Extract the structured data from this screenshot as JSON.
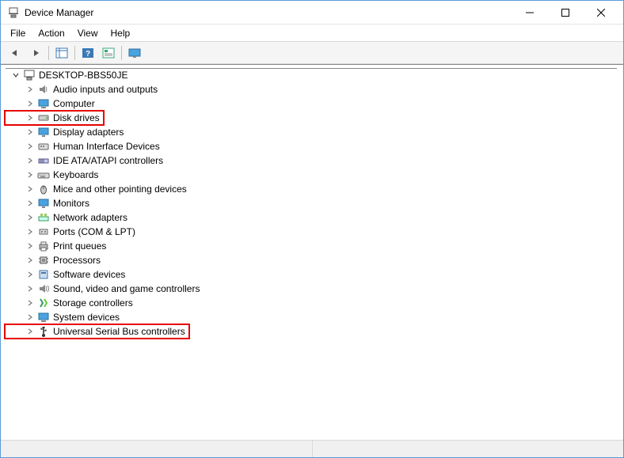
{
  "title": "Device Manager",
  "menu": {
    "items": [
      "File",
      "Action",
      "View",
      "Help"
    ]
  },
  "toolbar": {
    "buttons": [
      {
        "name": "back-button",
        "icon": "arrow-left"
      },
      {
        "name": "forward-button",
        "icon": "arrow-right"
      },
      {
        "name": "sep"
      },
      {
        "name": "show-hide-button",
        "icon": "table"
      },
      {
        "name": "sep"
      },
      {
        "name": "help-button",
        "icon": "help-square"
      },
      {
        "name": "properties-button",
        "icon": "props"
      },
      {
        "name": "sep"
      },
      {
        "name": "scan-button",
        "icon": "monitor"
      }
    ]
  },
  "tree": {
    "root": {
      "label": "DESKTOP-BBS50JE",
      "expanded": true,
      "icon": "computer"
    },
    "items": [
      {
        "label": "Audio inputs and outputs",
        "icon": "audio"
      },
      {
        "label": "Computer",
        "icon": "pc"
      },
      {
        "label": "Disk drives",
        "icon": "disk",
        "highlighted": true
      },
      {
        "label": "Display adapters",
        "icon": "display"
      },
      {
        "label": "Human Interface Devices",
        "icon": "hid"
      },
      {
        "label": "IDE ATA/ATAPI controllers",
        "icon": "ide"
      },
      {
        "label": "Keyboards",
        "icon": "keyboard"
      },
      {
        "label": "Mice and other pointing devices",
        "icon": "mouse"
      },
      {
        "label": "Monitors",
        "icon": "monitor"
      },
      {
        "label": "Network adapters",
        "icon": "network"
      },
      {
        "label": "Ports (COM & LPT)",
        "icon": "ports"
      },
      {
        "label": "Print queues",
        "icon": "printer"
      },
      {
        "label": "Processors",
        "icon": "cpu"
      },
      {
        "label": "Software devices",
        "icon": "software"
      },
      {
        "label": "Sound, video and game controllers",
        "icon": "sound"
      },
      {
        "label": "Storage controllers",
        "icon": "storage"
      },
      {
        "label": "System devices",
        "icon": "system"
      },
      {
        "label": "Universal Serial Bus controllers",
        "icon": "usb",
        "highlighted": true
      }
    ]
  }
}
